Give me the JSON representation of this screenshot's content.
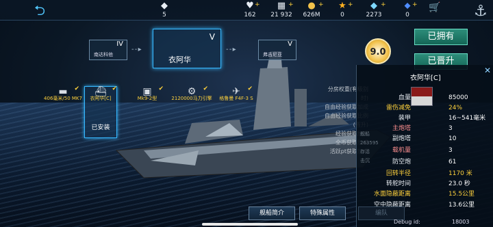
{
  "top": {
    "rank_count": "5",
    "hearts": "162",
    "silver": "21 932",
    "gold": "626M",
    "star": "0",
    "diamond": "2273",
    "gems": "0"
  },
  "tree": {
    "prev_name": "南达科他",
    "prev_tier": "IV",
    "current_name": "衣阿华",
    "current_tier": "V",
    "next_name": "弗吉尼亚",
    "next_tier": "V"
  },
  "score": "9.0",
  "buttons": {
    "owned": "已拥有",
    "upgraded": "已晋升"
  },
  "slots": [
    {
      "label": "406毫米/50 MK7",
      "icon": "gun-icon"
    },
    {
      "label": "衣阿华[C]",
      "icon": "hull-icon"
    },
    {
      "label": "Mk9-2型",
      "icon": "gun-icon"
    },
    {
      "label": "2120000马力引擎",
      "icon": "engine-icon"
    },
    {
      "label": "格鲁曼 F4F-3 S",
      "icon": "plane-icon"
    }
  ],
  "installed": "已安装",
  "left_list": [
    "分房权重(有级别时)",
    "自由经验获取加成",
    "自由经验获取比例(晋升)",
    "经验获取加成",
    "全币获取加成",
    "活跃pt获取加成"
  ],
  "panel": {
    "title": "衣阿华[C]",
    "rows": [
      {
        "k": "血量",
        "v": "85000"
      },
      {
        "k": "雷伤减免",
        "v": "24%"
      },
      {
        "k": "装甲",
        "v": "16~541毫米"
      },
      {
        "k": "主炮塔",
        "v": "3"
      },
      {
        "k": "副炮塔",
        "v": "10"
      },
      {
        "k": "载机量",
        "v": "3"
      },
      {
        "k": "防空炮",
        "v": "61"
      },
      {
        "k": "回转半径",
        "v": "1170 米"
      },
      {
        "k": "转舵时间",
        "v": "23.0 秒"
      },
      {
        "k": "水面隐蔽距离",
        "v": "15.5公里"
      },
      {
        "k": "空中隐蔽距离",
        "v": "13.6公里"
      }
    ],
    "ghost": [
      "舰船",
      "263595",
      "存活",
      "击沉"
    ]
  },
  "tabs": {
    "intro": "舰船简介",
    "attr": "特殊属性",
    "fleet": "编队"
  },
  "debug": {
    "label": "Debug id:",
    "value": "18003"
  }
}
